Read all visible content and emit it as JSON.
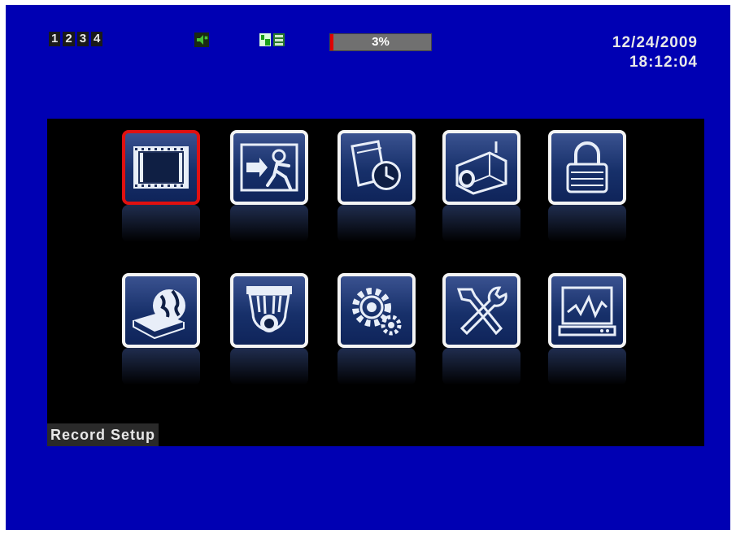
{
  "status_bar": {
    "channels": [
      "1",
      "2",
      "3",
      "4"
    ],
    "icons": [
      "audio-status-icon",
      "record-status-icon"
    ],
    "hdd_usage_label": "3%",
    "hdd_usage_percent": 3,
    "date": "12/24/2009",
    "time": "18:12:04"
  },
  "menu": {
    "selected_label": "Record Setup",
    "items": [
      {
        "id": "record-setup",
        "icon": "film-strip-icon",
        "selected": true
      },
      {
        "id": "event-setup",
        "icon": "motion-person-icon",
        "selected": false
      },
      {
        "id": "schedule-setup",
        "icon": "clock-calendar-icon",
        "selected": false
      },
      {
        "id": "camera-setup",
        "icon": "camera-icon",
        "selected": false
      },
      {
        "id": "account-setup",
        "icon": "padlock-icon",
        "selected": false
      },
      {
        "id": "network-setup",
        "icon": "globe-dvr-icon",
        "selected": false
      },
      {
        "id": "ptz-setup",
        "icon": "dome-camera-icon",
        "selected": false
      },
      {
        "id": "system-config",
        "icon": "gears-icon",
        "selected": false
      },
      {
        "id": "utility",
        "icon": "tools-icon",
        "selected": false
      },
      {
        "id": "diagnostic",
        "icon": "monitor-chart-icon",
        "selected": false
      }
    ]
  }
}
